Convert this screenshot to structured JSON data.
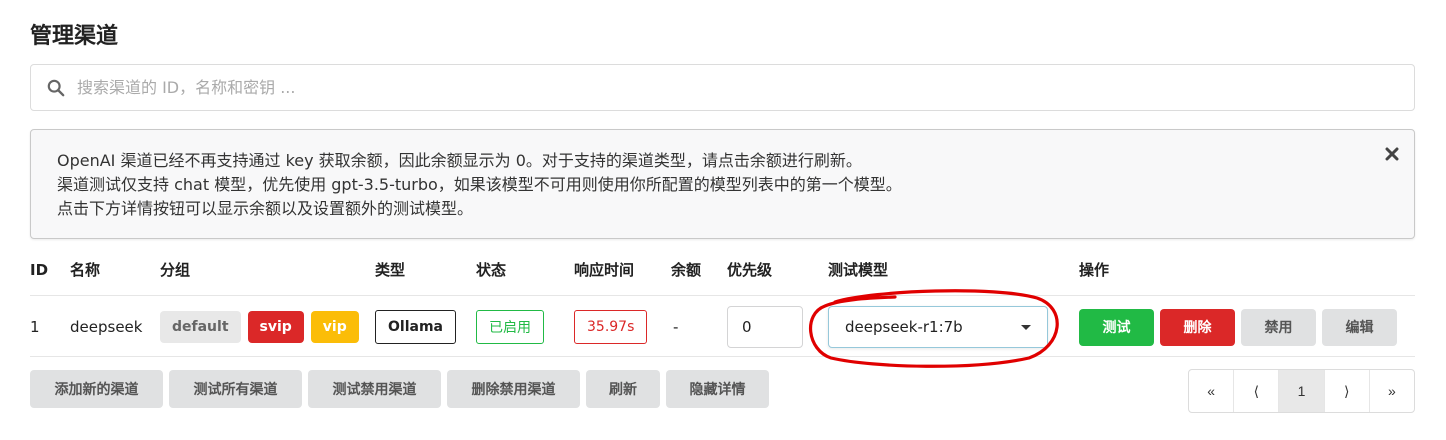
{
  "page": {
    "title": "管理渠道"
  },
  "search": {
    "placeholder": "搜索渠道的 ID，名称和密钥 ..."
  },
  "notice": {
    "lines": [
      "OpenAI 渠道已经不再支持通过 key 获取余额，因此余额显示为 0。对于支持的渠道类型，请点击余额进行刷新。",
      "渠道测试仅支持 chat 模型，优先使用 gpt-3.5-turbo，如果该模型不可用则使用你所配置的模型列表中的第一个模型。",
      "点击下方详情按钮可以显示余额以及设置额外的测试模型。"
    ]
  },
  "table": {
    "headers": [
      "ID",
      "名称",
      "分组",
      "类型",
      "状态",
      "响应时间",
      "余额",
      "优先级",
      "测试模型",
      "操作"
    ],
    "rows": [
      {
        "id": "1",
        "name": "deepseek",
        "groups": [
          "default",
          "svip",
          "vip"
        ],
        "type": "Ollama",
        "status": "已启用",
        "response_time": "35.97s",
        "balance": "-",
        "priority": "0",
        "test_model": "deepseek-r1:7b",
        "actions": [
          "测试",
          "删除",
          "禁用",
          "编辑"
        ]
      }
    ]
  },
  "footer": {
    "buttons": [
      "添加新的渠道",
      "测试所有渠道",
      "测试禁用渠道",
      "删除禁用渠道",
      "刷新",
      "隐藏详情"
    ]
  },
  "pagination": {
    "first": "«",
    "prev": "⟨",
    "current": "1",
    "next": "⟩",
    "last": "»"
  },
  "colors": {
    "green": "#21ba45",
    "red": "#db2828",
    "yellow": "#fbbd08",
    "grey": "#e0e1e2",
    "annotation": "#e00000"
  }
}
